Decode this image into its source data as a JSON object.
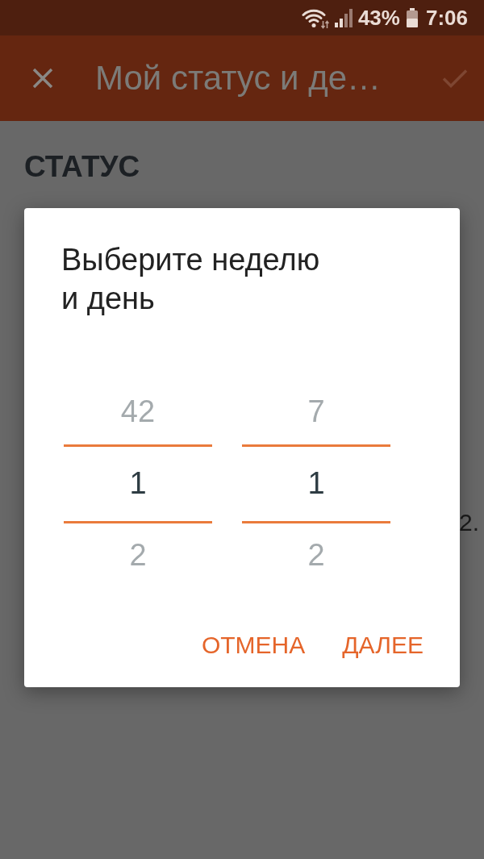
{
  "status_bar": {
    "battery_percent": "43%",
    "time": "7:06"
  },
  "app_bar": {
    "title": "Мой статус и де…"
  },
  "content": {
    "heading": "СТАТУС",
    "partial_text": "2."
  },
  "dialog": {
    "title": "Выберите неделю и день",
    "pickers": [
      {
        "values": [
          {
            "text": "42",
            "selected": false
          },
          {
            "text": "1",
            "selected": true
          },
          {
            "text": "2",
            "selected": false
          }
        ]
      },
      {
        "values": [
          {
            "text": "7",
            "selected": false
          },
          {
            "text": "1",
            "selected": true
          },
          {
            "text": "2",
            "selected": false
          }
        ]
      }
    ],
    "buttons": [
      "ОТМЕНА",
      "ДАЛЕЕ"
    ]
  }
}
